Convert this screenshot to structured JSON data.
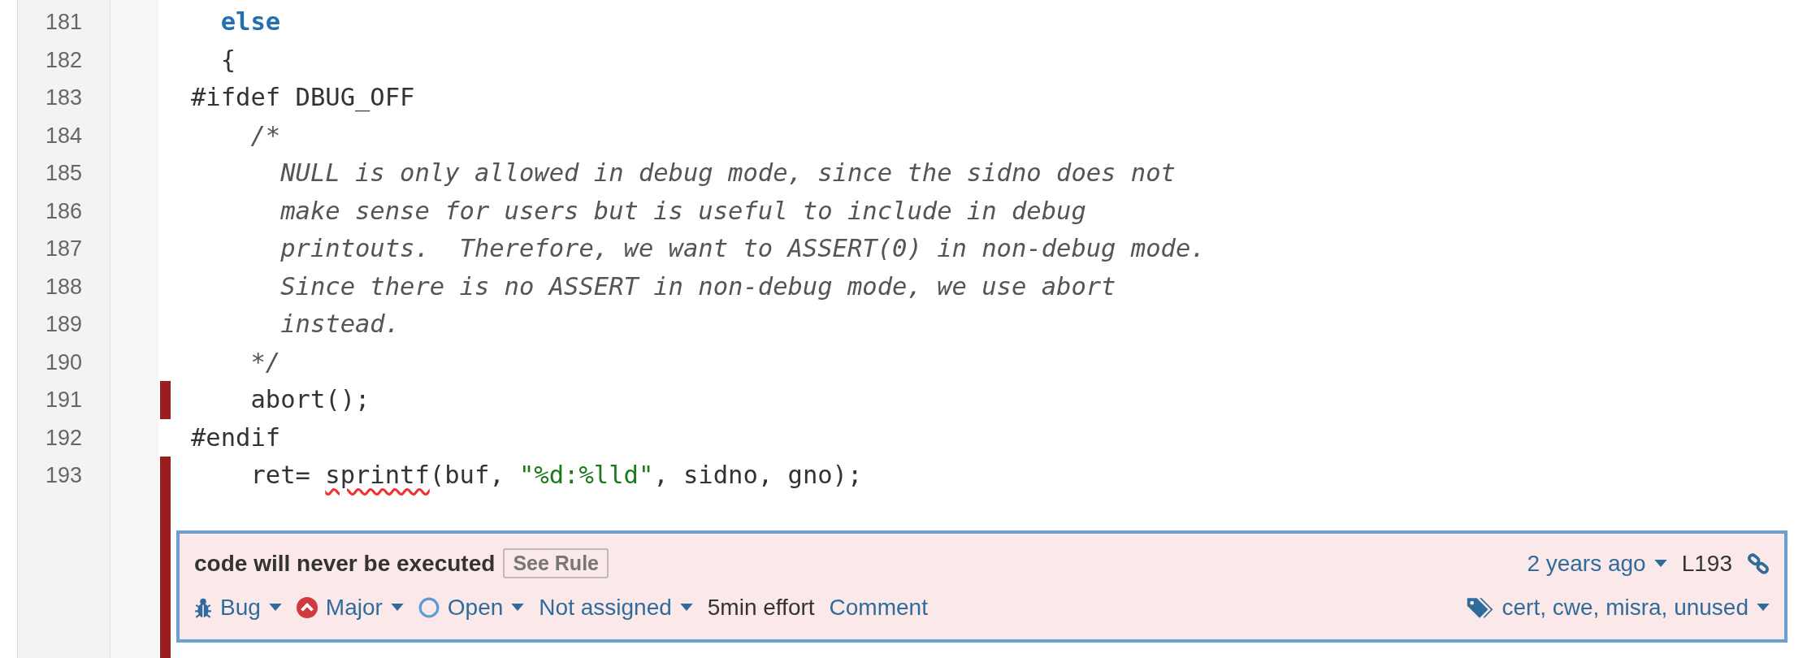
{
  "lines": [
    {
      "number": "181",
      "issue_marker": false,
      "segments": [
        {
          "kind": "keyword",
          "text": "  else"
        }
      ]
    },
    {
      "number": "182",
      "issue_marker": false,
      "segments": [
        {
          "kind": "plain",
          "text": "  {"
        }
      ]
    },
    {
      "number": "183",
      "issue_marker": false,
      "segments": [
        {
          "kind": "plain",
          "text": "#ifdef DBUG_OFF"
        }
      ]
    },
    {
      "number": "184",
      "issue_marker": false,
      "segments": [
        {
          "kind": "comment",
          "text": "    /*"
        }
      ]
    },
    {
      "number": "185",
      "issue_marker": false,
      "segments": [
        {
          "kind": "comment",
          "text": "      NULL is only allowed in debug mode, since the sidno does not"
        }
      ]
    },
    {
      "number": "186",
      "issue_marker": false,
      "segments": [
        {
          "kind": "comment",
          "text": "      make sense for users but is useful to include in debug"
        }
      ]
    },
    {
      "number": "187",
      "issue_marker": false,
      "segments": [
        {
          "kind": "comment",
          "text": "      printouts.  Therefore, we want to ASSERT(0) in non-debug mode."
        }
      ]
    },
    {
      "number": "188",
      "issue_marker": false,
      "segments": [
        {
          "kind": "comment",
          "text": "      Since there is no ASSERT in non-debug mode, we use abort"
        }
      ]
    },
    {
      "number": "189",
      "issue_marker": false,
      "segments": [
        {
          "kind": "comment",
          "text": "      instead."
        }
      ]
    },
    {
      "number": "190",
      "issue_marker": false,
      "segments": [
        {
          "kind": "comment",
          "text": "    */"
        }
      ]
    },
    {
      "number": "191",
      "issue_marker": true,
      "segments": [
        {
          "kind": "plain",
          "text": "    abort();"
        }
      ]
    },
    {
      "number": "192",
      "issue_marker": false,
      "segments": [
        {
          "kind": "plain",
          "text": "#endif"
        }
      ]
    },
    {
      "number": "193",
      "issue_marker": true,
      "segments": [
        {
          "kind": "plain",
          "text": "    ret= "
        },
        {
          "kind": "squiggle",
          "text": "sprintf"
        },
        {
          "kind": "plain",
          "text": "(buf, "
        },
        {
          "kind": "string",
          "text": "\"%d:%lld\""
        },
        {
          "kind": "plain",
          "text": ", sidno, gno);"
        }
      ]
    }
  ],
  "issue": {
    "selected": true,
    "message": "code will never be executed",
    "see_rule": "See Rule",
    "type": "Bug",
    "severity": "Major",
    "status": "Open",
    "assignee": "Not assigned",
    "effort": "5min effort",
    "comment": "Comment",
    "date": "2 years ago",
    "line": "L193",
    "tags": "cert, cwe, misra, unused"
  }
}
